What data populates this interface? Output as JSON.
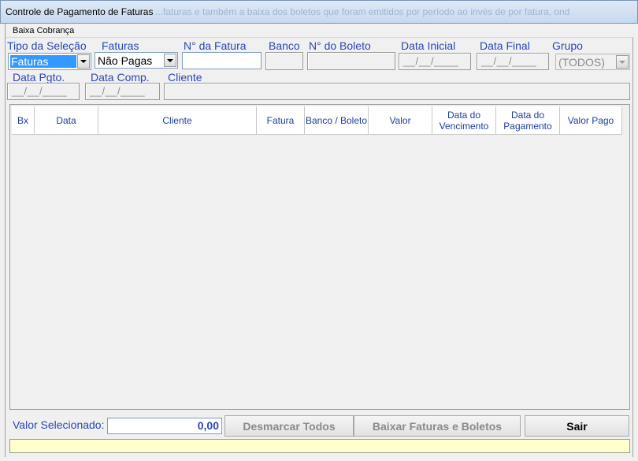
{
  "window": {
    "title": "Controle de Pagamento de Faturas",
    "title_faint": "...faturas e também a baixa dos boletos que foram emitidos por período ao invés de por fatura, ond"
  },
  "menu": {
    "item1": "Baixa Cobrança"
  },
  "filters": {
    "tipo_label": "Tipo da Seleção",
    "tipo_value": "Faturas",
    "faturas_label": "Faturas",
    "faturas_value": "Não Pagas",
    "num_fatura_label": "N° da Fatura",
    "num_fatura_value": "",
    "banco_label": "Banco",
    "banco_value": "",
    "num_boleto_label": "N° do Boleto",
    "num_boleto_value": "",
    "data_inicial_label": "Data Inicial",
    "data_inicial_value": "__/__/____",
    "data_final_label": "Data Final",
    "data_final_value": "__/__/____",
    "grupo_label": "Grupo",
    "grupo_value": "(TODOS)",
    "data_pgto_label": "Data Pgto.",
    "data_pgto_value": "__/__/____",
    "data_comp_label": "Data Comp.",
    "data_comp_value": "__/__/____",
    "cliente_label": "Cliente",
    "cliente_value": ""
  },
  "grid": {
    "columns": [
      {
        "key": "bx",
        "label": "Bx"
      },
      {
        "key": "data",
        "label": "Data"
      },
      {
        "key": "cliente",
        "label": "Cliente"
      },
      {
        "key": "fatura",
        "label": "Fatura"
      },
      {
        "key": "banco_boleto",
        "label": "Banco / Boleto"
      },
      {
        "key": "valor",
        "label": "Valor"
      },
      {
        "key": "data_venc",
        "label": "Data do Vencimento"
      },
      {
        "key": "data_pag",
        "label": "Data do Pagamento"
      },
      {
        "key": "valor_pago",
        "label": "Valor Pago"
      }
    ],
    "rows": []
  },
  "footer": {
    "valor_label": "Valor Selecionado:",
    "valor_value": "0,00",
    "btn_desmarcar": "Desmarcar Todos",
    "btn_baixar": "Baixar Faturas e Boletos",
    "btn_sair": "Sair"
  },
  "colors": {
    "label_blue": "#2a46b6",
    "status_yellow": "#ffffcc",
    "selection_blue": "#3399ff"
  }
}
